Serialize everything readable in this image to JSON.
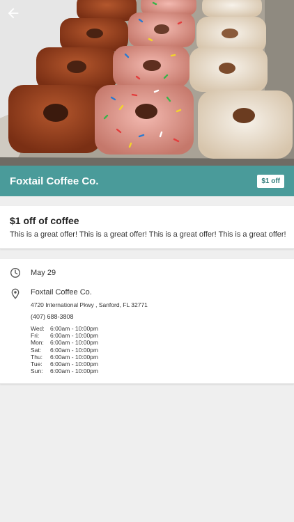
{
  "header": {
    "back_icon": "arrow-left-icon",
    "merchant_name": "Foxtail Coffee Co.",
    "badge": "$1 off"
  },
  "offer": {
    "title": "$1 off of coffee",
    "description": "This is a great offer! This is a great offer! This is a great offer! This is a great offer!"
  },
  "details": {
    "date_icon": "clock-icon",
    "date": "May 29",
    "location_icon": "map-pin-icon",
    "location_name": "Foxtail Coffee Co.",
    "address": "4720 International Pkwy , Sanford, FL 32771",
    "phone": "(407) 688-3808",
    "hours": [
      {
        "day": "Wed:",
        "time": "6:00am - 10:00pm"
      },
      {
        "day": "Fri:",
        "time": "6:00am - 10:00pm"
      },
      {
        "day": "Mon:",
        "time": "6:00am - 10:00pm"
      },
      {
        "day": "Sat:",
        "time": "6:00am - 10:00pm"
      },
      {
        "day": "Thu:",
        "time": "6:00am - 10:00pm"
      },
      {
        "day": "Tue:",
        "time": "6:00am - 10:00pm"
      },
      {
        "day": "Sun:",
        "time": "6:00am - 10:00pm"
      }
    ]
  },
  "colors": {
    "accent": "#4a9b9a",
    "background": "#efefef"
  }
}
